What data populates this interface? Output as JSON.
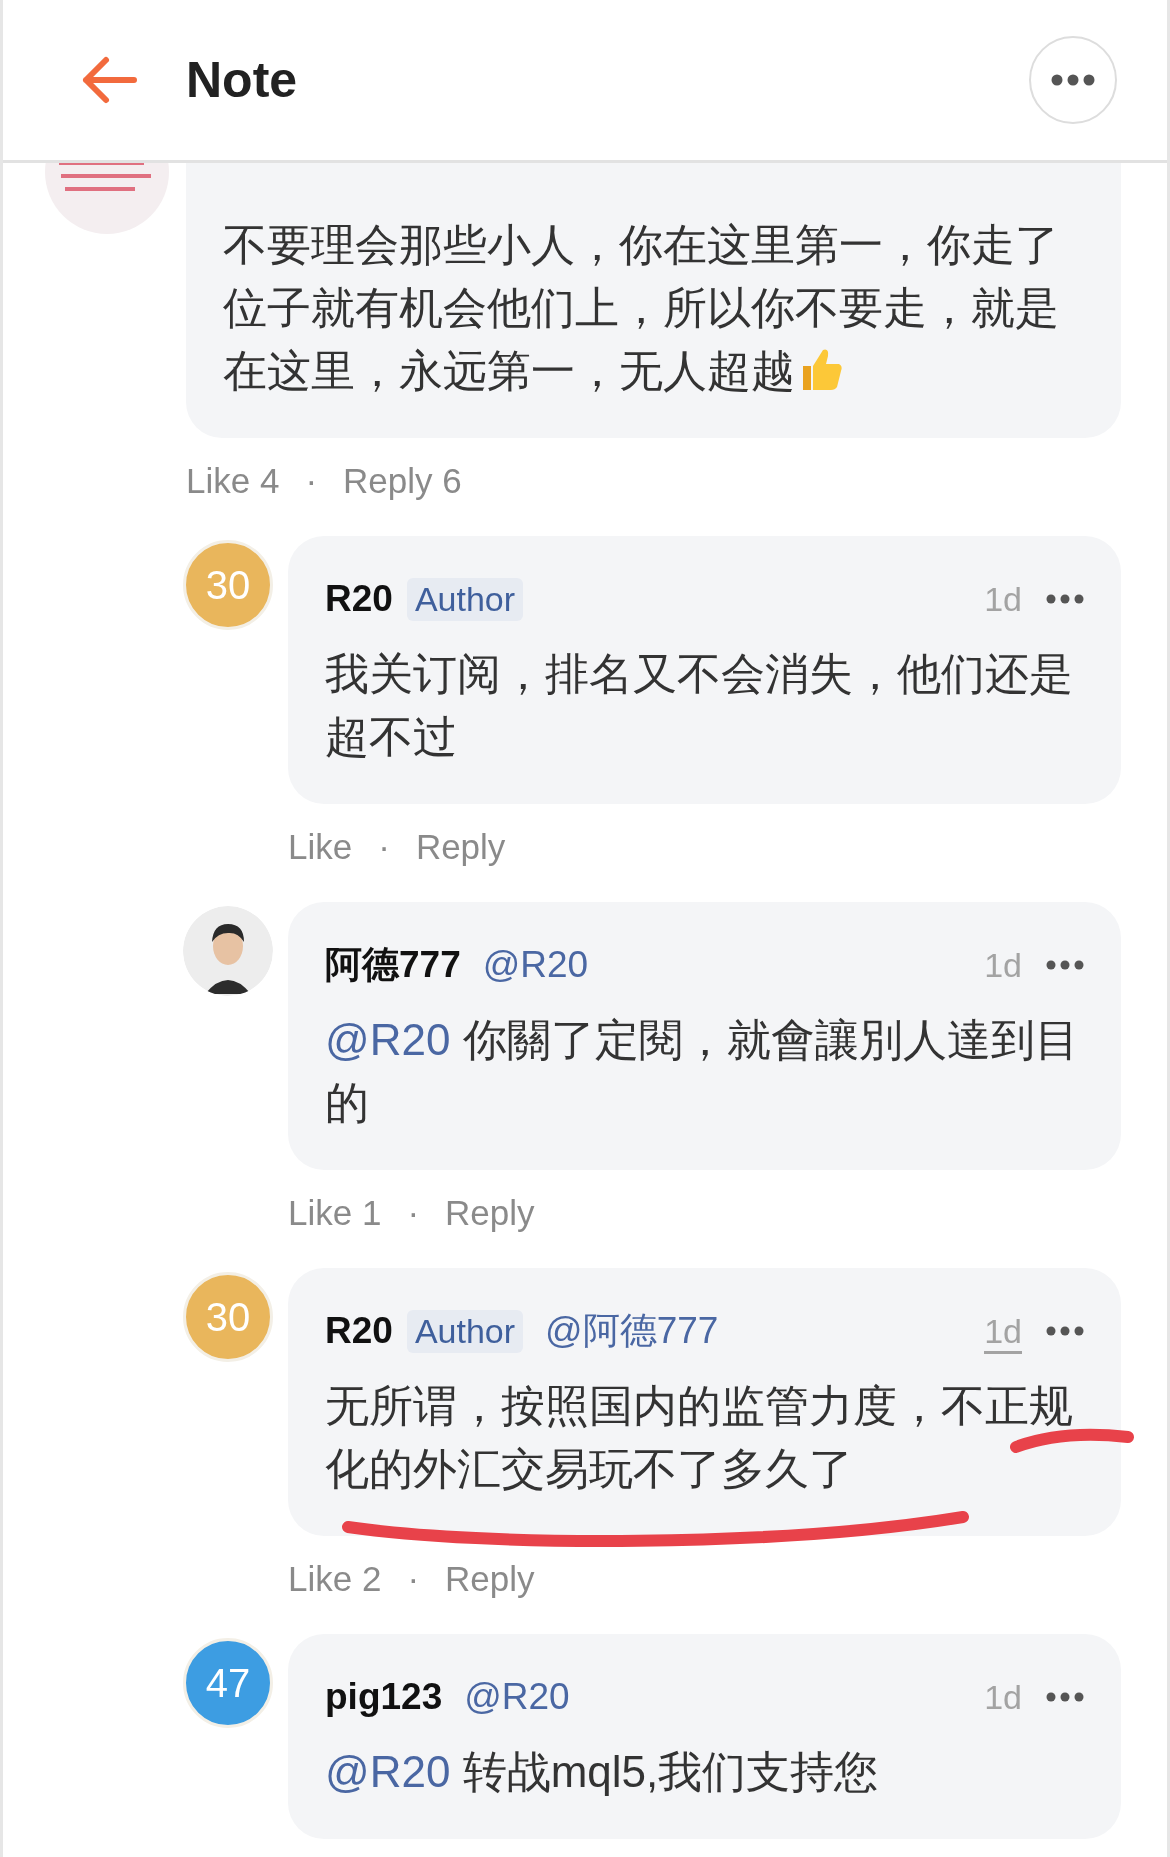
{
  "header": {
    "title": "Note"
  },
  "comments": [
    {
      "kind": "comment",
      "body": "不要理会那些小人，你在这里第一，你走了位子就有机会他们上，所以你不要走，就是在这里，永远第一，无人超越",
      "ends_with_icon": true,
      "like": "Like 4",
      "sep": "·",
      "reply": "Reply 6",
      "highlighted": false
    },
    {
      "kind": "reply",
      "avatar": {
        "kind": "level",
        "text": "30",
        "color": "#e9b65c"
      },
      "name": "R20",
      "badge": "Author",
      "time": "1d",
      "body": "我关订阅，排名又不会消失，他们还是超不过",
      "ends_with_icon": false,
      "like": "Like",
      "sep": "·",
      "reply": "Reply",
      "highlighted": false,
      "time_underlined": false
    },
    {
      "kind": "reply",
      "avatar": {
        "kind": "person"
      },
      "name": "阿德777",
      "mention": "@R20",
      "time": "1d",
      "body_mention": "@R20",
      "body": "你關了定閱，就會讓別人達到目的",
      "ends_with_icon": false,
      "like": "Like 1",
      "sep": "·",
      "reply": "Reply",
      "highlighted": false,
      "time_underlined": false
    },
    {
      "kind": "reply",
      "avatar": {
        "kind": "level",
        "text": "30",
        "color": "#e9b65c"
      },
      "name": "R20",
      "badge": "Author",
      "mention": "@阿德777",
      "time": "1d",
      "body": "无所谓，按照国内的监管力度，不正规化的外汇交易玩不了多久了",
      "ends_with_icon": false,
      "like": "Like 2",
      "sep": "·",
      "reply": "Reply",
      "highlighted": true,
      "time_underlined": true
    },
    {
      "kind": "reply",
      "avatar": {
        "kind": "level",
        "text": "47",
        "color": "#3d9de2"
      },
      "name": "pig123",
      "mention": "@R20",
      "time": "1d",
      "body_mention": "@R20",
      "body": "转战mql5,我们支持您",
      "ends_with_icon": false,
      "highlighted": false,
      "time_underlined": false
    }
  ]
}
